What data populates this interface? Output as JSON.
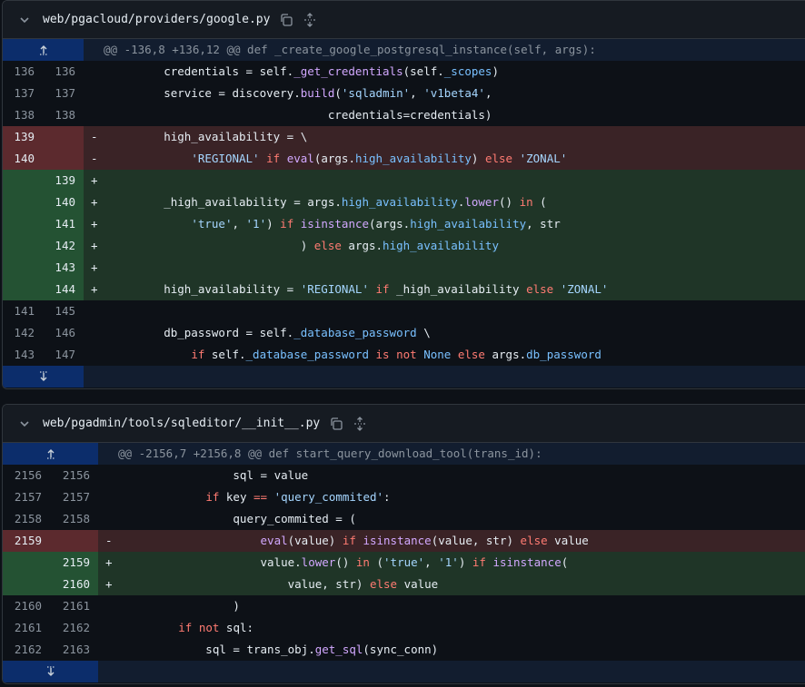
{
  "files": [
    {
      "path": "web/pgacloud/providers/google.py",
      "hunk_header": "@@ -136,8 +136,12 @@ def _create_google_postgresql_instance(self, args):",
      "lines": [
        {
          "type": "ctx",
          "old": "136",
          "new": "136",
          "sign": " ",
          "tokens": [
            [
              "pl",
              "        credentials = self."
            ],
            [
              "fn",
              "_get_credentials"
            ],
            [
              "pl",
              "(self."
            ],
            [
              "at",
              "_scopes"
            ],
            [
              "pl",
              ")"
            ]
          ]
        },
        {
          "type": "ctx",
          "old": "137",
          "new": "137",
          "sign": " ",
          "tokens": [
            [
              "pl",
              "        service = discovery."
            ],
            [
              "fn",
              "build"
            ],
            [
              "pl",
              "("
            ],
            [
              "st",
              "'sqladmin'"
            ],
            [
              "pl",
              ", "
            ],
            [
              "st",
              "'v1beta4'"
            ],
            [
              "pl",
              ","
            ]
          ]
        },
        {
          "type": "ctx",
          "old": "138",
          "new": "138",
          "sign": " ",
          "tokens": [
            [
              "pl",
              "                                credentials=credentials)"
            ]
          ]
        },
        {
          "type": "del",
          "old": "139",
          "new": "",
          "sign": "-",
          "tokens": [
            [
              "pl",
              "        high_availability = \\"
            ]
          ]
        },
        {
          "type": "del",
          "old": "140",
          "new": "",
          "sign": "-",
          "tokens": [
            [
              "pl",
              "            "
            ],
            [
              "st",
              "'REGIONAL'"
            ],
            [
              "pl",
              " "
            ],
            [
              "kw",
              "if"
            ],
            [
              "pl",
              " "
            ],
            [
              "fn",
              "eval"
            ],
            [
              "pl",
              "(args."
            ],
            [
              "at",
              "high_availability"
            ],
            [
              "pl",
              ") "
            ],
            [
              "kw",
              "else"
            ],
            [
              "pl",
              " "
            ],
            [
              "st",
              "'ZONAL'"
            ]
          ]
        },
        {
          "type": "add",
          "old": "",
          "new": "139",
          "sign": "+",
          "tokens": [
            [
              "pl",
              ""
            ]
          ]
        },
        {
          "type": "add",
          "old": "",
          "new": "140",
          "sign": "+",
          "tokens": [
            [
              "pl",
              "        _high_availability = args."
            ],
            [
              "at",
              "high_availability"
            ],
            [
              "pl",
              "."
            ],
            [
              "fn",
              "lower"
            ],
            [
              "pl",
              "() "
            ],
            [
              "kw",
              "in"
            ],
            [
              "pl",
              " ("
            ]
          ]
        },
        {
          "type": "add",
          "old": "",
          "new": "141",
          "sign": "+",
          "tokens": [
            [
              "pl",
              "            "
            ],
            [
              "st",
              "'true'"
            ],
            [
              "pl",
              ", "
            ],
            [
              "st",
              "'1'"
            ],
            [
              "pl",
              ") "
            ],
            [
              "kw",
              "if"
            ],
            [
              "pl",
              " "
            ],
            [
              "fn",
              "isinstance"
            ],
            [
              "pl",
              "(args."
            ],
            [
              "at",
              "high_availability"
            ],
            [
              "pl",
              ", str"
            ]
          ]
        },
        {
          "type": "add",
          "old": "",
          "new": "142",
          "sign": "+",
          "tokens": [
            [
              "pl",
              "                            ) "
            ],
            [
              "kw",
              "else"
            ],
            [
              "pl",
              " args."
            ],
            [
              "at",
              "high_availability"
            ]
          ]
        },
        {
          "type": "add",
          "old": "",
          "new": "143",
          "sign": "+",
          "tokens": [
            [
              "pl",
              ""
            ]
          ]
        },
        {
          "type": "add",
          "old": "",
          "new": "144",
          "sign": "+",
          "tokens": [
            [
              "pl",
              "        high_availability = "
            ],
            [
              "st",
              "'REGIONAL'"
            ],
            [
              "pl",
              " "
            ],
            [
              "kw",
              "if"
            ],
            [
              "pl",
              " _high_availability "
            ],
            [
              "kw",
              "else"
            ],
            [
              "pl",
              " "
            ],
            [
              "st",
              "'ZONAL'"
            ]
          ]
        },
        {
          "type": "ctx",
          "old": "141",
          "new": "145",
          "sign": " ",
          "tokens": [
            [
              "pl",
              ""
            ]
          ]
        },
        {
          "type": "ctx",
          "old": "142",
          "new": "146",
          "sign": " ",
          "tokens": [
            [
              "pl",
              "        db_password = self."
            ],
            [
              "at",
              "_database_password"
            ],
            [
              "pl",
              " \\"
            ]
          ]
        },
        {
          "type": "ctx",
          "old": "143",
          "new": "147",
          "sign": " ",
          "tokens": [
            [
              "pl",
              "            "
            ],
            [
              "kw",
              "if"
            ],
            [
              "pl",
              " self."
            ],
            [
              "at",
              "_database_password"
            ],
            [
              "pl",
              " "
            ],
            [
              "kw",
              "is not"
            ],
            [
              "pl",
              " "
            ],
            [
              "at",
              "None"
            ],
            [
              "pl",
              " "
            ],
            [
              "kw",
              "else"
            ],
            [
              "pl",
              " args."
            ],
            [
              "at",
              "db_password"
            ]
          ]
        }
      ]
    },
    {
      "path": "web/pgadmin/tools/sqleditor/__init__.py",
      "hunk_header": "@@ -2156,7 +2156,8 @@ def start_query_download_tool(trans_id):",
      "lines": [
        {
          "type": "ctx",
          "old": "2156",
          "new": "2156",
          "sign": " ",
          "tokens": [
            [
              "pl",
              "                sql = value"
            ]
          ]
        },
        {
          "type": "ctx",
          "old": "2157",
          "new": "2157",
          "sign": " ",
          "tokens": [
            [
              "pl",
              "            "
            ],
            [
              "kw",
              "if"
            ],
            [
              "pl",
              " key "
            ],
            [
              "kw",
              "=="
            ],
            [
              "pl",
              " "
            ],
            [
              "st",
              "'query_commited'"
            ],
            [
              "pl",
              ":"
            ]
          ]
        },
        {
          "type": "ctx",
          "old": "2158",
          "new": "2158",
          "sign": " ",
          "tokens": [
            [
              "pl",
              "                query_commited = ("
            ]
          ]
        },
        {
          "type": "del",
          "old": "2159",
          "new": "",
          "sign": "-",
          "tokens": [
            [
              "pl",
              "                    "
            ],
            [
              "fn",
              "eval"
            ],
            [
              "pl",
              "(value) "
            ],
            [
              "kw",
              "if"
            ],
            [
              "pl",
              " "
            ],
            [
              "fn",
              "isinstance"
            ],
            [
              "pl",
              "(value, str) "
            ],
            [
              "kw",
              "else"
            ],
            [
              "pl",
              " value"
            ]
          ]
        },
        {
          "type": "add",
          "old": "",
          "new": "2159",
          "sign": "+",
          "tokens": [
            [
              "pl",
              "                    value."
            ],
            [
              "fn",
              "lower"
            ],
            [
              "pl",
              "() "
            ],
            [
              "kw",
              "in"
            ],
            [
              "pl",
              " ("
            ],
            [
              "st",
              "'true'"
            ],
            [
              "pl",
              ", "
            ],
            [
              "st",
              "'1'"
            ],
            [
              "pl",
              ") "
            ],
            [
              "kw",
              "if"
            ],
            [
              "pl",
              " "
            ],
            [
              "fn",
              "isinstance"
            ],
            [
              "pl",
              "("
            ]
          ]
        },
        {
          "type": "add",
          "old": "",
          "new": "2160",
          "sign": "+",
          "tokens": [
            [
              "pl",
              "                        value, str) "
            ],
            [
              "kw",
              "else"
            ],
            [
              "pl",
              " value"
            ]
          ]
        },
        {
          "type": "ctx",
          "old": "2160",
          "new": "2161",
          "sign": " ",
          "tokens": [
            [
              "pl",
              "                )"
            ]
          ]
        },
        {
          "type": "ctx",
          "old": "2161",
          "new": "2162",
          "sign": " ",
          "tokens": [
            [
              "pl",
              "        "
            ],
            [
              "kw",
              "if"
            ],
            [
              "pl",
              " "
            ],
            [
              "kw",
              "not"
            ],
            [
              "pl",
              " sql:"
            ]
          ]
        },
        {
          "type": "ctx",
          "old": "2162",
          "new": "2163",
          "sign": " ",
          "tokens": [
            [
              "pl",
              "            sql = trans_obj."
            ],
            [
              "fn",
              "get_sql"
            ],
            [
              "pl",
              "(sync_conn)"
            ]
          ]
        }
      ]
    }
  ],
  "icons": {
    "collapse": "chevron-down-icon",
    "copy": "copy-icon",
    "expand_all": "unfold-icon",
    "expand_up": "expand-up-icon",
    "expand_down": "expand-down-icon"
  },
  "colors": {
    "background": "#0d1117",
    "header": "#161b22",
    "hunk_gutter": "#0c2d6b",
    "deleted_line": "#3a2326",
    "deleted_gutter": "#5c2a2e",
    "added_line": "#1f3527",
    "added_gutter": "#245233",
    "keyword": "#ff7b72",
    "function": "#d2a8ff",
    "string": "#a5d6ff",
    "attribute": "#79c0ff"
  }
}
